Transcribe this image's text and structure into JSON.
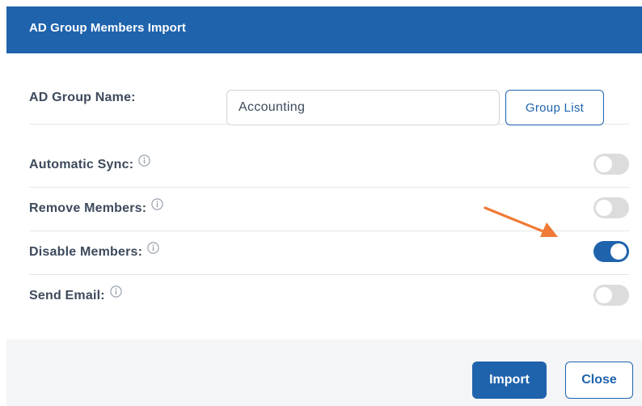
{
  "dialog": {
    "title": "AD Group Members Import"
  },
  "form": {
    "group_name_label": "AD Group Name:",
    "group_name_value": "Accounting",
    "group_list_label": "Group List",
    "rows": [
      {
        "label": "Automatic Sync:",
        "enabled": false
      },
      {
        "label": "Remove Members:",
        "enabled": false
      },
      {
        "label": "Disable Members:",
        "enabled": true
      },
      {
        "label": "Send Email:",
        "enabled": false
      }
    ]
  },
  "footer": {
    "import_label": "Import",
    "close_label": "Close"
  },
  "colors": {
    "primary": "#1f63ad",
    "toggle_off": "#dcdcdc",
    "annotation_arrow": "#f07a36",
    "footer_bg": "#f4f5f6"
  },
  "icons": {
    "info": "info-circle-icon",
    "annotation": "annotation-arrow-icon"
  }
}
